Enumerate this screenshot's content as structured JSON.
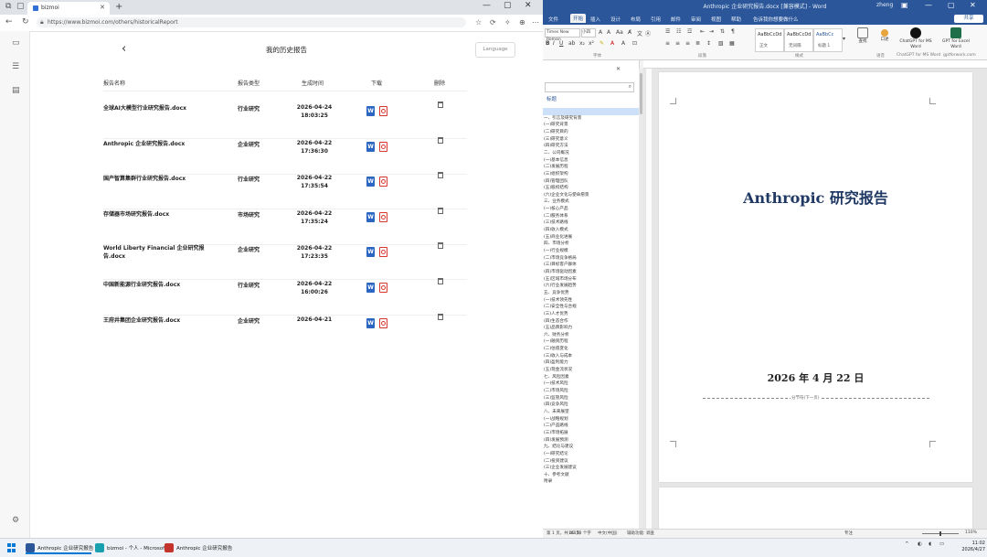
{
  "browser": {
    "tab_title": "bizmoi",
    "url": "https://www.bizmoi.com/others/historicalReport",
    "page": {
      "title": "我的历史报告",
      "language_button": "Language",
      "columns": [
        "报告名称",
        "报告类型",
        "生成时间",
        "下载",
        "删除"
      ],
      "rows": [
        {
          "name": "全球AI大模型行业研究报告.docx",
          "type": "行业研究",
          "date": "2026-04-24",
          "time": "18:03:25"
        },
        {
          "name": "Anthropic 企业研究报告.docx",
          "type": "企业研究",
          "date": "2026-04-22",
          "time": "17:36:30"
        },
        {
          "name": "国产智算集群行业研究报告.docx",
          "type": "行业研究",
          "date": "2026-04-22",
          "time": "17:35:54"
        },
        {
          "name": "存储器市场研究报告.docx",
          "type": "市场研究",
          "date": "2026-04-22",
          "time": "17:35:24"
        },
        {
          "name": "World Liberty Financial 企业研究报告.docx",
          "type": "企业研究",
          "date": "2026-04-22",
          "time": "17:23:35"
        },
        {
          "name": "中国新能源行业研究报告.docx",
          "type": "行业研究",
          "date": "2026-04-22",
          "time": "16:00:26"
        },
        {
          "name": "王府井集团企业研究报告.docx",
          "type": "企业研究",
          "date": "2026-04-21",
          "time": ""
        }
      ]
    }
  },
  "word": {
    "window_title": "Anthropic 企业研究报告.docx [兼容模式] - Word",
    "user": "zheng",
    "share_label": "共享",
    "ribbon_tabs": [
      "文件",
      "开始",
      "插入",
      "设计",
      "布局",
      "引用",
      "邮件",
      "审阅",
      "视图",
      "帮助",
      "告诉我你想要做什么"
    ],
    "font_name": "Times New Roman",
    "font_size": "小四",
    "styles": [
      {
        "sample": "AaBbCcDd",
        "name": "正文"
      },
      {
        "sample": "AaBbCcDd",
        "name": "无间隔"
      },
      {
        "sample": "AaBbCc",
        "name": "标题 1"
      }
    ],
    "ribbon_buttons": [
      {
        "label": "查找"
      },
      {
        "label": "口述"
      },
      {
        "label": "ChatGPT for MS Word"
      },
      {
        "label": "GPT for Excel Word"
      }
    ],
    "group_labels": [
      "字体",
      "段落",
      "样式",
      "语音",
      "ChatGPT for MS Word",
      "gptforwork.com"
    ],
    "nav_pane": {
      "header": "导航",
      "tabs": "标题",
      "items": [
        "",
        "一、引言及研究背景",
        "(一)研究背景",
        "(二)研究目的",
        "(三)研究意义",
        "(四)研究方法",
        "二、公司概况",
        "(一)基本信息",
        "(二)发展历程",
        "(三)组织架构",
        "(四)管理团队",
        "(五)股权结构",
        "(六)企业文化与使命愿景",
        "三、业务模式",
        "(一)核心产品",
        "(二)服务体系",
        "(三)技术路线",
        "(四)收入模式",
        "(五)商业化进展",
        "四、市场分析",
        "(一)行业规模",
        "(二)市场竞争格局",
        "(三)目标客户群体",
        "(四)市场驱动因素",
        "(五)区域市场分布",
        "(六)行业发展趋势",
        "五、竞争优势",
        "(一)技术领先性",
        "(二)安全性与合规",
        "(三)人才优势",
        "(四)生态合作",
        "(五)品牌影响力",
        "六、财务分析",
        "(一)融资历程",
        "(二)估值变化",
        "(三)收入与成本",
        "(四)盈利能力",
        "(五)现金流状况",
        "七、风险因素",
        "(一)技术风险",
        "(二)市场风险",
        "(三)监管风险",
        "(四)竞争风险",
        "八、未来展望",
        "(一)战略规划",
        "(二)产品路线",
        "(三)市场拓展",
        "(四)发展预测",
        "九、结论与建议",
        "(一)研究结论",
        "(二)投资建议",
        "(三)企业发展建议",
        "十、参考文献",
        "附录"
      ]
    },
    "document": {
      "title": "Anthropic 研究报告",
      "date": "2026 年 4 月 22 日",
      "section_break": "分节符(下一页)"
    },
    "status": {
      "page": "第 1 页，共 40 页",
      "words": "16158 个字",
      "language": "中文(中国)",
      "accessibility": "辅助功能: 调查",
      "focus": "专注",
      "zoom": "110%"
    }
  },
  "taskbar": {
    "items": [
      {
        "label": "Anthropic 企业研究报告",
        "icon_color": "#2b579a"
      },
      {
        "label": "bizmoi - 个人 - Microsoft",
        "icon_color": "#1aa1b0"
      },
      {
        "label": "Anthropic 企业研究报告",
        "icon_color": "#c4342c"
      }
    ],
    "clock_time": "11:02",
    "clock_date": "2026/4/27"
  }
}
